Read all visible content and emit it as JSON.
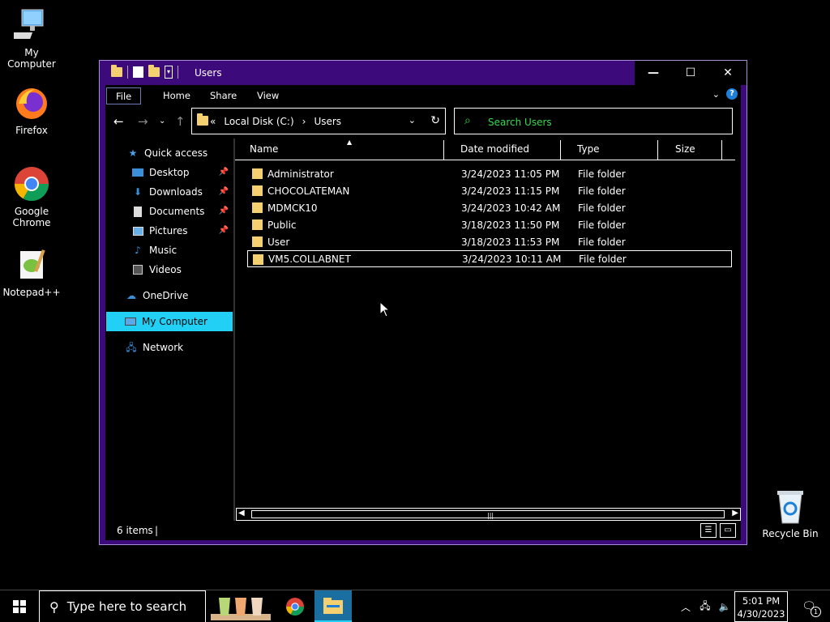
{
  "desktop": {
    "icons": [
      {
        "label": "My Computer"
      },
      {
        "label": "Firefox"
      },
      {
        "label": "Google Chrome"
      },
      {
        "label": "Notepad++"
      },
      {
        "label": "Recycle Bin"
      }
    ]
  },
  "window": {
    "title": "Users",
    "controls": {
      "minimize": "—",
      "maximize": "☐",
      "close": "✕"
    }
  },
  "ribbon": {
    "tabs": [
      "File",
      "Home",
      "Share",
      "View"
    ]
  },
  "address": {
    "prefix": "«",
    "segments": [
      "Local Disk (C:)",
      "›",
      "Users"
    ]
  },
  "search": {
    "placeholder": "Search Users"
  },
  "navpane": {
    "items": [
      {
        "label": "Quick access",
        "icon": "star-icon"
      },
      {
        "label": "Desktop",
        "icon": "desktop-icon",
        "pinned": true
      },
      {
        "label": "Downloads",
        "icon": "download-icon",
        "pinned": true
      },
      {
        "label": "Documents",
        "icon": "document-icon",
        "pinned": true
      },
      {
        "label": "Pictures",
        "icon": "picture-icon",
        "pinned": true
      },
      {
        "label": "Music",
        "icon": "music-icon"
      },
      {
        "label": "Videos",
        "icon": "video-icon"
      },
      {
        "label": "OneDrive",
        "icon": "cloud-icon"
      },
      {
        "label": "My Computer",
        "icon": "computer-icon",
        "selected": true
      },
      {
        "label": "Network",
        "icon": "network-icon"
      }
    ]
  },
  "filelist": {
    "columns": [
      "Name",
      "Date modified",
      "Type",
      "Size"
    ],
    "rows": [
      {
        "name": "Administrator",
        "date": "3/24/2023 11:05 PM",
        "type": "File folder"
      },
      {
        "name": "CHOCOLATEMAN",
        "date": "3/24/2023 11:15 PM",
        "type": "File folder"
      },
      {
        "name": "MDMCK10",
        "date": "3/24/2023 10:42 AM",
        "type": "File folder"
      },
      {
        "name": "Public",
        "date": "3/18/2023 11:50 PM",
        "type": "File folder"
      },
      {
        "name": "User",
        "date": "3/18/2023 11:53 PM",
        "type": "File folder"
      },
      {
        "name": "VM5.COLLABNET",
        "date": "3/24/2023 10:11 AM",
        "type": "File folder",
        "selected": true
      }
    ]
  },
  "status": {
    "items_text": "6 items",
    "sep": "|"
  },
  "taskbar": {
    "search_placeholder": "Type here to search",
    "time": "5:01 PM",
    "date": "4/30/2023",
    "notification_count": "1"
  },
  "colors": {
    "title_bg": "#3c0a7a",
    "accent": "#22d0f5",
    "search_text": "#38d94f",
    "folder": "#f5d070"
  }
}
